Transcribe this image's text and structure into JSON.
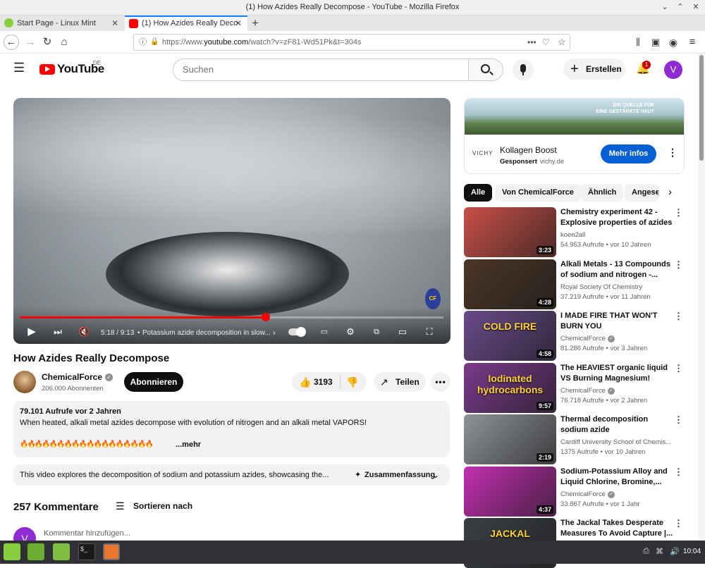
{
  "window": {
    "title": "(1) How Azides Really Decompose - YouTube - Mozilla Firefox"
  },
  "tabs": [
    {
      "label": "Start Page - Linux Mint"
    },
    {
      "label": "(1) How Azides Really Deco"
    }
  ],
  "nav": {
    "url_prefix": "https://www.",
    "url_domain": "youtube.com",
    "url_rest": "/watch?v=zF81-Wd51Pk&t=304s"
  },
  "header": {
    "logo": "YouTube",
    "region": "DE",
    "search_placeholder": "Suchen",
    "create_label": "Erstellen",
    "notif_count": "1",
    "avatar_letter": "V"
  },
  "player": {
    "time": "5:18 / 9:13",
    "chapter": "Potassium azide decomposition in slow...",
    "progress": 0.58,
    "watermark": "CF"
  },
  "video": {
    "title": "How Azides Really Decompose",
    "channel": "ChemicalForce",
    "subscribers": "206.000 Abonnenten",
    "subscribe_label": "Abonnieren",
    "likes": "3193",
    "share_label": "Teilen",
    "views_age": "79.101 Aufrufe  vor 2 Jahren",
    "description": "When heated, alkali metal azides decompose with evolution of nitrogen and an alkali metal VAPORS!",
    "description_emoji": "🔥🔥🔥🔥🔥🔥🔥🔥🔥🔥🔥🔥🔥🔥🔥🔥🔥🔥",
    "more_label": "...mehr",
    "summary_text": "This video explores the decomposition of sodium and potassium azides, showcasing the...",
    "summary_label": "Zusammenfassung"
  },
  "comments": {
    "count_label": "257 Kommentare",
    "sort_label": "Sortieren nach",
    "placeholder": "Kommentar hinzufügen...",
    "avatar_letter": "V"
  },
  "ad": {
    "banner_text_1": "DIE QUELLE FÜR",
    "banner_text_2": "EINE GESTÄRKTE HAUT",
    "brand": "VICHY",
    "title": "Kollagen Boost",
    "sponsored": "Gesponsert",
    "domain": "vichy.de",
    "cta": "Mehr infos"
  },
  "chips": [
    "Alle",
    "Von ChemicalForce",
    "Ähnlich",
    "Angesehen"
  ],
  "recommendations": [
    {
      "title": "Chemistry experiment 42 - Explosive properties of azides",
      "channel": "koen2all",
      "meta": "54.953 Aufrufe • vor 10 Jahren",
      "duration": "3:23",
      "thumb_color": "#c85048"
    },
    {
      "title": "Alkali Metals - 13 Compounds of sodium and nitrogen -...",
      "channel": "Royal Society Of Chemistry",
      "meta": "37.219 Aufrufe • vor 11 Jahren",
      "duration": "4:28",
      "thumb_color": "#4a3626"
    },
    {
      "title": "I MADE FIRE THAT WON'T BURN YOU",
      "channel": "ChemicalForce",
      "meta": "81.286 Aufrufe • vor 3 Jahren",
      "duration": "4:58",
      "thumb_color": "#6a4a8a",
      "thumb_text": "COLD FIRE"
    },
    {
      "title": "The HEAVIEST organic liquid VS Burning Magnesium!",
      "channel": "ChemicalForce",
      "meta": "76.718 Aufrufe • vor 2 Jahren",
      "duration": "9:57",
      "thumb_color": "#7a3a8a",
      "thumb_text": "Iodinated hydrocarbons"
    },
    {
      "title": "Thermal decomposition sodium azide",
      "channel": "Cardiff University School of Chemis...",
      "meta": "1375 Aufrufe • vor 10 Jahren",
      "duration": "2:19",
      "thumb_color": "#8f9398"
    },
    {
      "title": "Sodium-Potassium Alloy and Liquid Chlorine, Bromine,...",
      "channel": "ChemicalForce",
      "meta": "33.867 Aufrufe • vor 1 Jahr",
      "duration": "4:37",
      "thumb_color": "#c22fb0"
    },
    {
      "title": "The Jackal Takes Desperate Measures To Avoid Capture |...",
      "channel": "",
      "meta": "",
      "duration": "",
      "thumb_color": "#3b3f44",
      "thumb_text": "JACKAL"
    }
  ],
  "taskbar": {
    "clock": "10:04"
  }
}
